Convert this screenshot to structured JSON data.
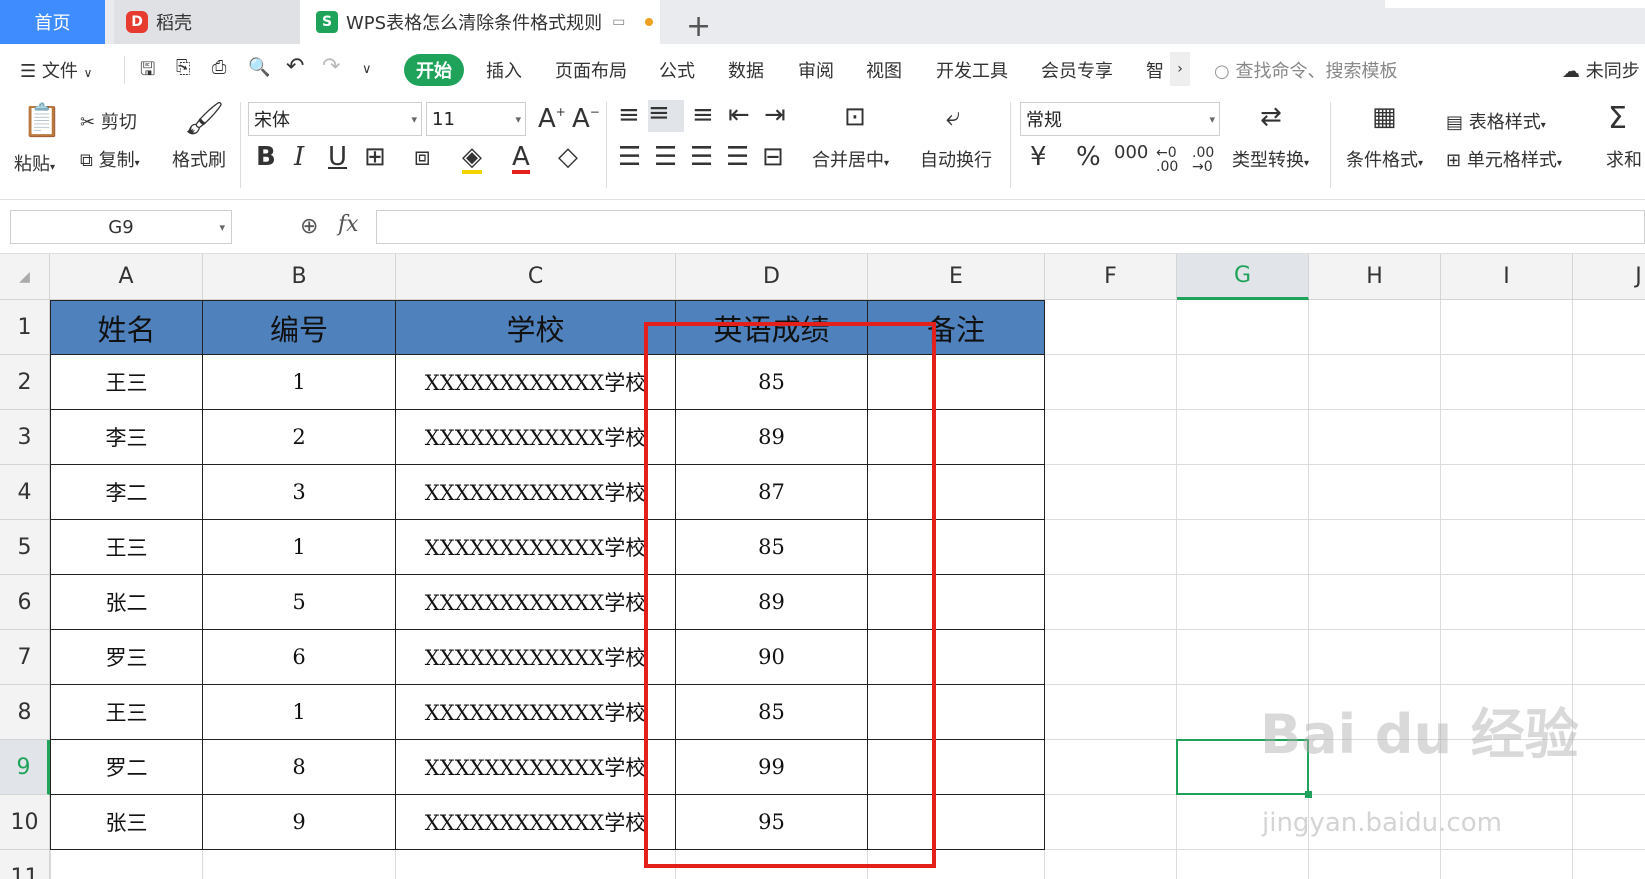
{
  "tabs": {
    "home": "首页",
    "daoke": "稻壳",
    "doc": "WPS表格怎么清除条件格式规则",
    "plus": "+"
  },
  "menu": {
    "file": "文件",
    "items": [
      "插入",
      "页面布局",
      "公式",
      "数据",
      "审阅",
      "视图",
      "开发工具",
      "会员专享",
      "智"
    ],
    "start": "开始",
    "search": "查找命令、搜索模板",
    "sync": "未同步"
  },
  "ribbon": {
    "paste": "粘贴",
    "cut": "剪切",
    "copy": "复制",
    "format_painter": "格式刷",
    "font": "宋体",
    "size": "11",
    "merge": "合并居中",
    "wrap": "自动换行",
    "numfmt": "常规",
    "type_convert": "类型转换",
    "cond_format": "条件格式",
    "table_style": "表格样式",
    "cell_style": "单元格样式",
    "sum": "求和"
  },
  "formula": {
    "namebox": "G9",
    "fx": "fx",
    "value": ""
  },
  "sheet": {
    "columns": [
      "A",
      "B",
      "C",
      "D",
      "E",
      "F",
      "G",
      "H",
      "I",
      "J"
    ],
    "rows": [
      "1",
      "2",
      "3",
      "4",
      "5",
      "6",
      "7",
      "8",
      "9",
      "10",
      "11"
    ],
    "selected_cell": "G9",
    "header": [
      "姓名",
      "编号",
      "学校",
      "英语成绩",
      "备注"
    ],
    "data": [
      [
        "王三",
        "1",
        "XXXXXXXXXXXX学校",
        "85",
        ""
      ],
      [
        "李三",
        "2",
        "XXXXXXXXXXXX学校",
        "89",
        ""
      ],
      [
        "李二",
        "3",
        "XXXXXXXXXXXX学校",
        "87",
        ""
      ],
      [
        "王三",
        "1",
        "XXXXXXXXXXXX学校",
        "85",
        ""
      ],
      [
        "张二",
        "5",
        "XXXXXXXXXXXX学校",
        "89",
        ""
      ],
      [
        "罗三",
        "6",
        "XXXXXXXXXXXX学校",
        "90",
        ""
      ],
      [
        "王三",
        "1",
        "XXXXXXXXXXXX学校",
        "85",
        ""
      ],
      [
        "罗二",
        "8",
        "XXXXXXXXXXXX学校",
        "99",
        ""
      ],
      [
        "张三",
        "9",
        "XXXXXXXXXXXX学校",
        "95",
        ""
      ]
    ]
  },
  "watermark": {
    "brand": "Bai du 经验",
    "url": "jingyan.baidu.com"
  },
  "colors": {
    "header_fill": "#4f81bd",
    "accent": "#1fa35a",
    "highlight": "#e3201b"
  }
}
